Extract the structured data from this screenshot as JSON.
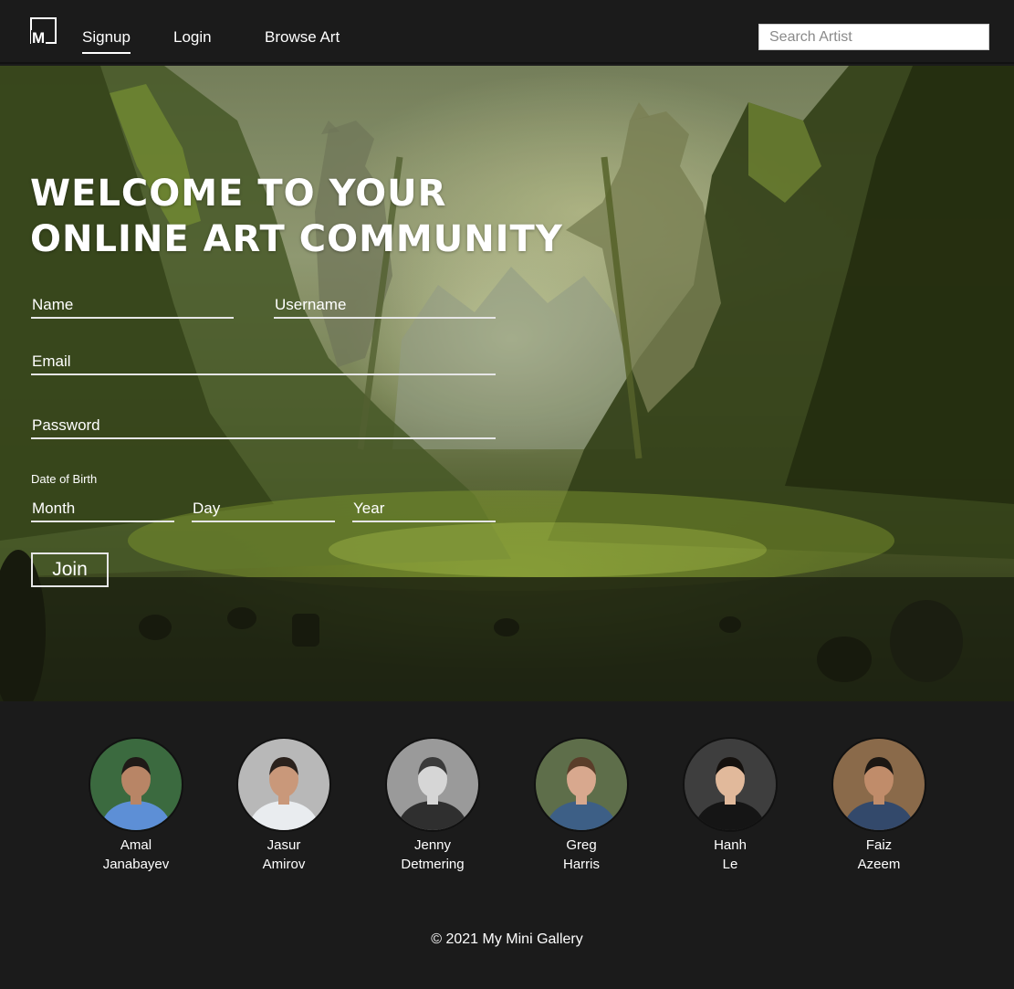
{
  "nav": {
    "logo_letter": "M",
    "links": [
      {
        "label": "Signup",
        "active": true
      },
      {
        "label": "Login",
        "active": false
      },
      {
        "label": "Browse Art",
        "active": false
      }
    ],
    "search_placeholder": "Search Artist"
  },
  "hero": {
    "title_line1": "WELCOME TO YOUR",
    "title_line2": "ONLINE ART COMMUNITY"
  },
  "form": {
    "name_placeholder": "Name",
    "username_placeholder": "Username",
    "email_placeholder": "Email",
    "password_placeholder": "Password",
    "dob_label": "Date of Birth",
    "month_placeholder": "Month",
    "day_placeholder": "Day",
    "year_placeholder": "Year",
    "join_label": "Join"
  },
  "team": [
    {
      "first": "Amal",
      "last": "Janabayev",
      "bg": "#3b6a3f",
      "shirt": "#5d8fd6",
      "skin": "#b88566",
      "hair": "#1f1a17"
    },
    {
      "first": "Jasur",
      "last": "Amirov",
      "bg": "#b8b8b8",
      "shirt": "#e9ecef",
      "skin": "#c9987a",
      "hair": "#2a211c"
    },
    {
      "first": "Jenny",
      "last": "Detmering",
      "bg": "#9a9a9a",
      "shirt": "#2f2f2f",
      "skin": "#d6d6d6",
      "hair": "#3a3a3a"
    },
    {
      "first": "Greg",
      "last": "Harris",
      "bg": "#5e6e4a",
      "shirt": "#3d5f86",
      "skin": "#d8a88e",
      "hair": "#5a3e2a"
    },
    {
      "first": "Hanh",
      "last": "Le",
      "bg": "#3e3e3e",
      "shirt": "#151515",
      "skin": "#e1b99b",
      "hair": "#15110e"
    },
    {
      "first": "Faiz",
      "last": "Azeem",
      "bg": "#8a6a4a",
      "shirt": "#33496b",
      "skin": "#c08c6a",
      "hair": "#1c1713"
    }
  ],
  "footer": {
    "copyright": "© 2021 My Mini Gallery"
  }
}
